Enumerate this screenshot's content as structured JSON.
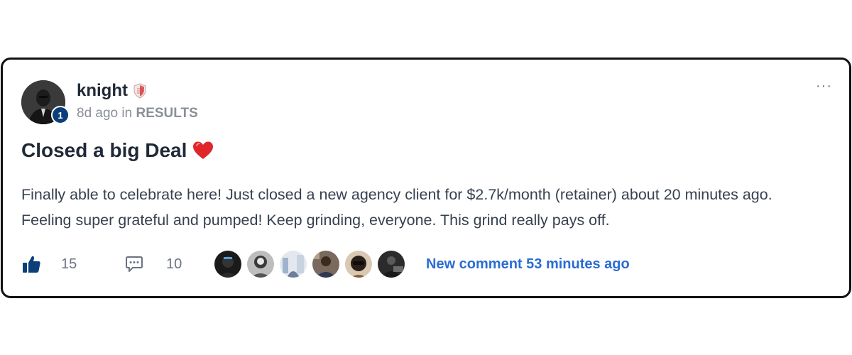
{
  "post": {
    "author": "knight",
    "author_level": "1",
    "time_ago": "8d ago",
    "in_word": "in",
    "category": "RESULTS",
    "more_menu": "···",
    "title": "Closed a big Deal",
    "body": "Finally able to celebrate here! Just closed a new agency client for $2.7k/month (retainer) about 20 minutes ago. Feeling super grateful and pumped! Keep grinding, everyone. This grind really pays off.",
    "likes": "15",
    "comments": "10",
    "new_comment": "New comment 53 minutes ago"
  },
  "icons": {
    "author_badge": "shield-icon",
    "title_emoji": "heart-icon",
    "like": "thumbs-up-icon",
    "comment": "comment-bubble-icon",
    "more": "more-horizontal-icon"
  },
  "colors": {
    "accent": "#2b6cd4",
    "like_icon": "#0b3f7a",
    "level_badge": "#0b3f7a",
    "heart": "#e0262b",
    "muted_text": "#8a8f98"
  }
}
